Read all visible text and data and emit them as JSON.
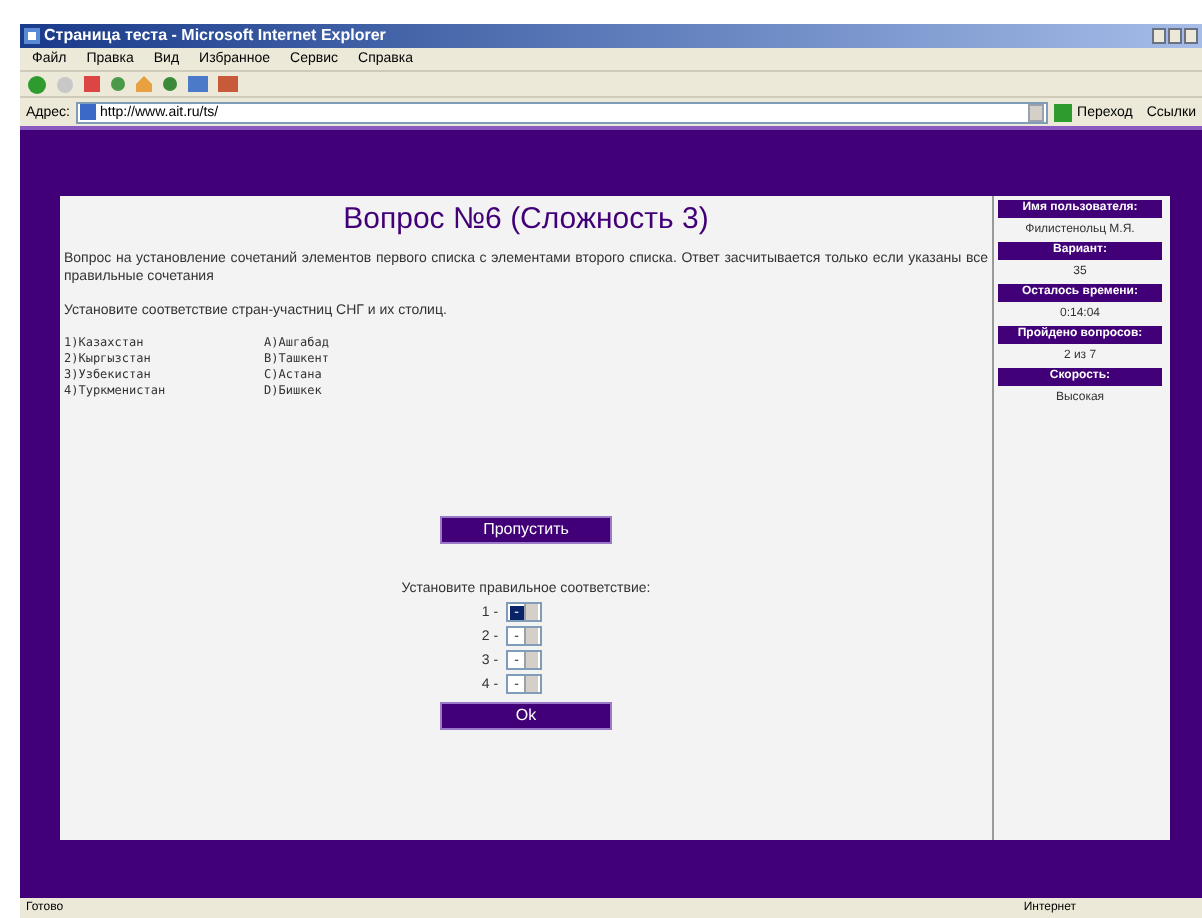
{
  "window": {
    "title": "Страница теста - Microsoft Internet Explorer"
  },
  "menu": [
    "Файл",
    "Правка",
    "Вид",
    "Избранное",
    "Сервис",
    "Справка"
  ],
  "address": {
    "label": "Адрес:",
    "value": "http://www.ait.ru/ts/",
    "go": "Переход",
    "links": "Ссылки"
  },
  "question": {
    "title": "Вопрос №6 (Сложность 3)",
    "description": "Вопрос на установление сочетаний элементов первого списка с элементами второго списка. Ответ засчитывается только если указаны все правильные сочетания",
    "task": "Установите соответствие стран-участниц СНГ и их столиц.",
    "left": [
      "1)Казахстан",
      "2)Кыргызстан",
      "3)Узбекистан",
      "4)Туркменистан"
    ],
    "right": [
      "A)Ашгабад",
      "B)Ташкент",
      "C)Астана",
      "D)Бишкек"
    ]
  },
  "skip_button": "Пропустить",
  "match_prompt": "Установите правильное соответствие:",
  "selects": [
    {
      "label": "1 -",
      "value": "-",
      "focused": true
    },
    {
      "label": "2 -",
      "value": "-",
      "focused": false
    },
    {
      "label": "3 -",
      "value": "-",
      "focused": false
    },
    {
      "label": "4 -",
      "value": "-",
      "focused": false
    }
  ],
  "ok_button": "Ok",
  "sidebar": [
    {
      "heading": "Имя пользователя:",
      "value": "Филистенольц М.Я."
    },
    {
      "heading": "Вариант:",
      "value": "35"
    },
    {
      "heading": "Осталось времени:",
      "value": "0:14:04"
    },
    {
      "heading": "Пройдено вопросов:",
      "value": "2 из 7"
    },
    {
      "heading": "Скорость:",
      "value": "Высокая"
    }
  ],
  "status_bar": {
    "text": "Готово",
    "zone": "Интернет"
  }
}
